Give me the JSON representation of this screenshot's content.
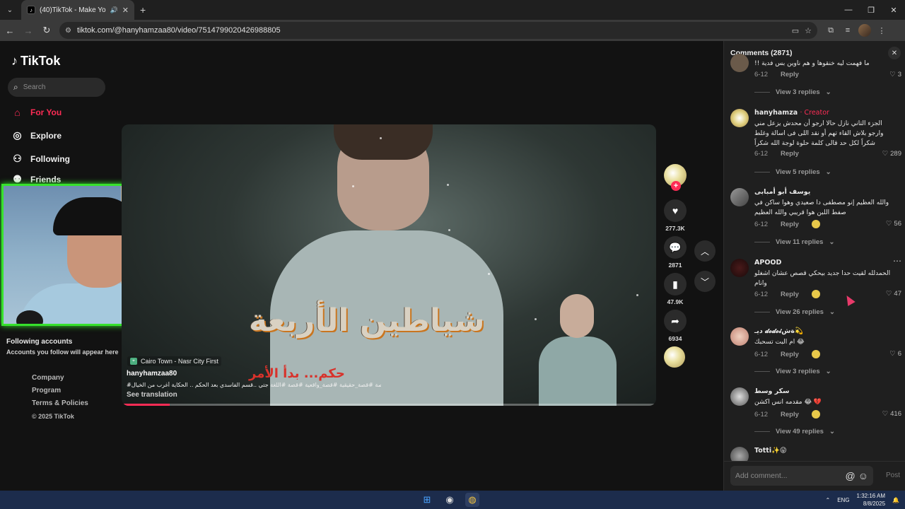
{
  "browser": {
    "tab_title": "(40)TikTok - Make Your Day",
    "url": "tiktok.com/@hanyhamzaa80/video/7514799020426988805"
  },
  "nav": {
    "logo": "TikTok",
    "search_placeholder": "Search",
    "items": [
      {
        "label": "For You",
        "icon": "home-icon",
        "active": true
      },
      {
        "label": "Explore",
        "icon": "compass-icon"
      },
      {
        "label": "Following",
        "icon": "user-icon"
      },
      {
        "label": "Friends",
        "icon": "users-icon"
      }
    ],
    "following_accounts_title": "Following accounts",
    "following_accounts_sub": "Accounts you follow will appear here",
    "footer": [
      "Company",
      "Program",
      "Terms & Policies"
    ],
    "copyright": "© 2025 TikTok"
  },
  "video": {
    "overlay_title": "شياطين الأربعة",
    "overlay_sub": "حكم... بدأ الأمر",
    "location": "Cairo Town - Nasr City First",
    "author": "hanyhamzaa80",
    "caption": "#قصة #قصة_حقيقية #قصة_واقعية #قصة #اللغة جتي ..قسم الفاسدي بعد الحكم .. الحكاية أغرب من الخيال",
    "see_translation": "See translation",
    "progress": 0.09
  },
  "actions": {
    "likes": "277.3K",
    "comments": "2871",
    "saves": "47.9K",
    "shares": "6934"
  },
  "comments_panel": {
    "title": "Comments (2871)",
    "add_placeholder": "Add comment...",
    "post_label": "Post",
    "items": [
      {
        "name": "",
        "text": "!! ما فهمت ليه خنقوها و هم ناوين بس فدية",
        "date": "6-12",
        "reply": "Reply",
        "likes": "3",
        "replies": "View 3 replies"
      },
      {
        "name": "hanyhamza",
        "creator": "· Creator",
        "text": "الجزء التاني نازل حالا ارجو أن محدش يزعل مني وارجو بلاش القاء تهم أو نقد اللى فى اسالة وغلط شكراً لكل حد قالى كلمة حلوة لوجة الله شكراً",
        "date": "6-12",
        "reply": "Reply",
        "likes": "289",
        "replies": "View 5 replies"
      },
      {
        "name": "يوسف أبو أمبابى",
        "text": "والله العظيم إنو مصطفى دا صعيدي وهوا ساكن في صفط اللبن هوا قريبي والله العظيم",
        "date": "6-12",
        "reply": "Reply",
        "likes": "56",
        "replies": "View 11 replies"
      },
      {
        "name": "APOOD",
        "text": "الحمدلله لقيت حدا جديد بيحكي قصص عشان اشغلو وانام",
        "date": "6-12",
        "reply": "Reply",
        "likes": "47",
        "replies": "View 26 replies"
      },
      {
        "name": "ديـ 𝓭𝓸𝓭𝓸𝓲ةش💫",
        "text": "ام البت تسحبك 😂",
        "date": "6-12",
        "reply": "Reply",
        "likes": "6",
        "replies": "View 3 replies"
      },
      {
        "name": "سكر وسط",
        "text": "مقدمه انس اكشن 😂 💔",
        "date": "6-12",
        "reply": "Reply",
        "likes": "416",
        "replies": "View 49 replies"
      },
      {
        "name": "Totti✨😜",
        "text": "",
        "date": "",
        "reply": "",
        "likes": "",
        "replies": ""
      }
    ]
  },
  "taskbar": {
    "lang": "ENG",
    "time": "1:32:16 AM",
    "date": "8/8/2025"
  },
  "colors": {
    "accent": "#fe2c55",
    "webcam_border": "#37e22c",
    "panel_bg": "#1f1f1f",
    "taskbar_bg": "#1c2c4c"
  }
}
